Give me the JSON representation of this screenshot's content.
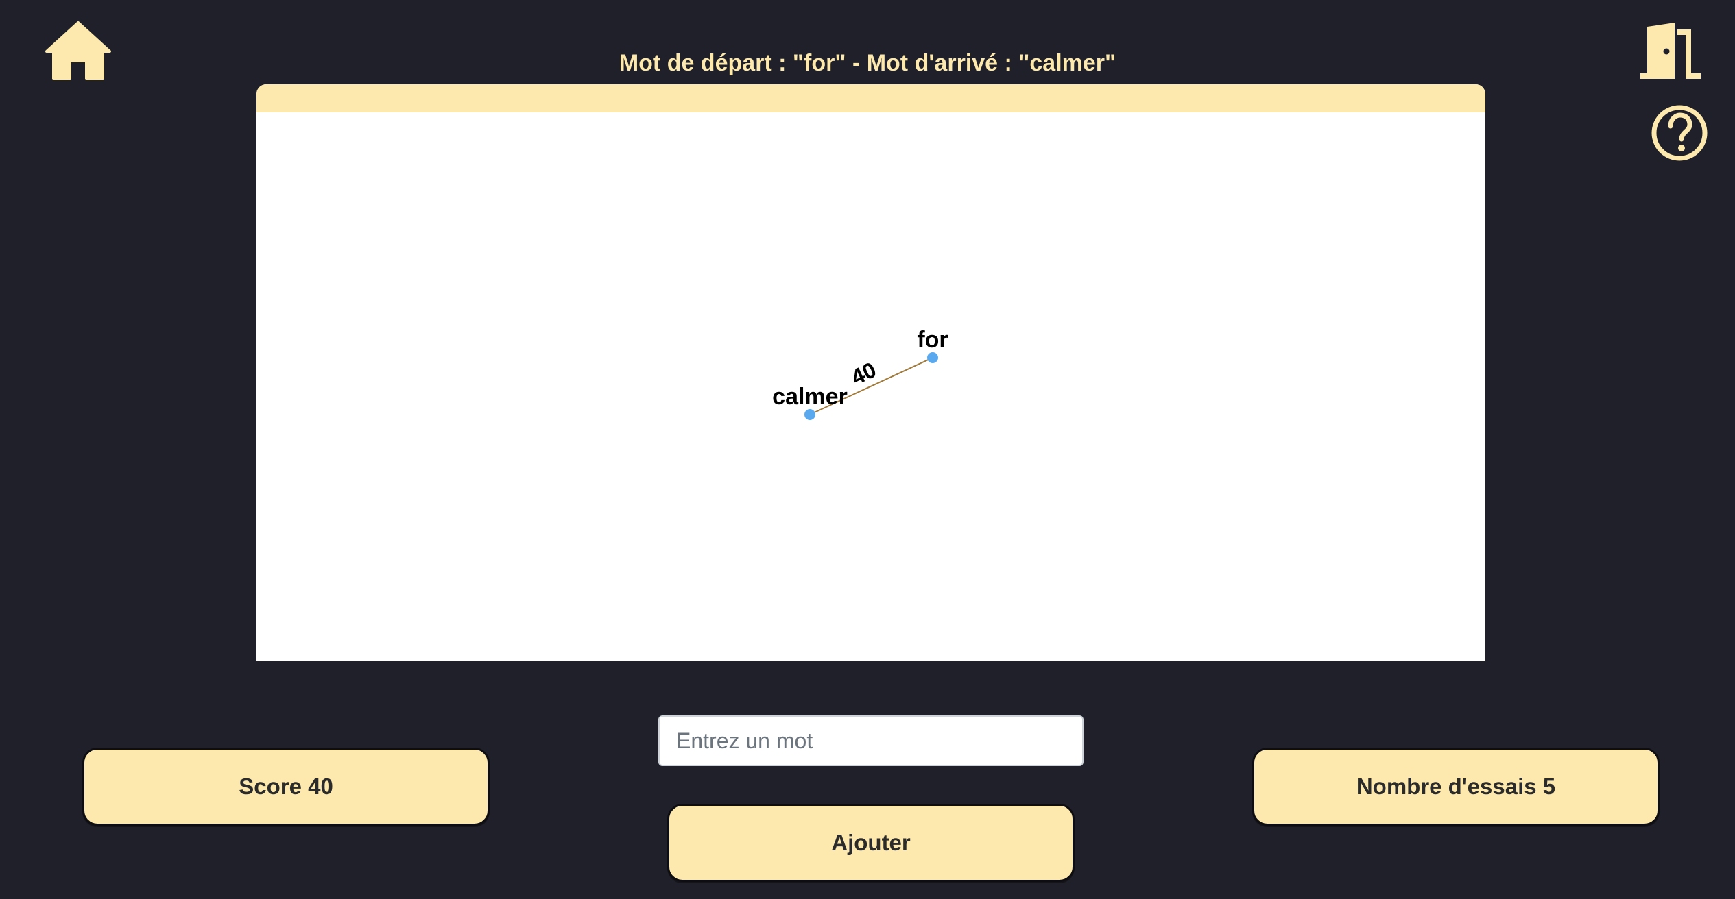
{
  "header": {
    "goal_title": "Mot de départ : \"for\" - Mot d'arrivé : \"calmer\""
  },
  "icons": {
    "home": "home-icon",
    "exit": "door-exit-icon",
    "help": "question-circle-icon"
  },
  "colors": {
    "background": "#1f2029",
    "accent": "#fde9ad",
    "node": "#5aa9ef",
    "edge": "#a07a3c"
  },
  "graph": {
    "nodes": [
      {
        "id": "for",
        "label": "for"
      },
      {
        "id": "calmer",
        "label": "calmer"
      }
    ],
    "edges": [
      {
        "from": "for",
        "to": "calmer",
        "label": "40"
      }
    ]
  },
  "input": {
    "placeholder": "Entrez un mot",
    "value": ""
  },
  "buttons": {
    "add_label": "Ajouter"
  },
  "stats": {
    "score_label": "Score 40",
    "tries_label": "Nombre d'essais 5"
  }
}
